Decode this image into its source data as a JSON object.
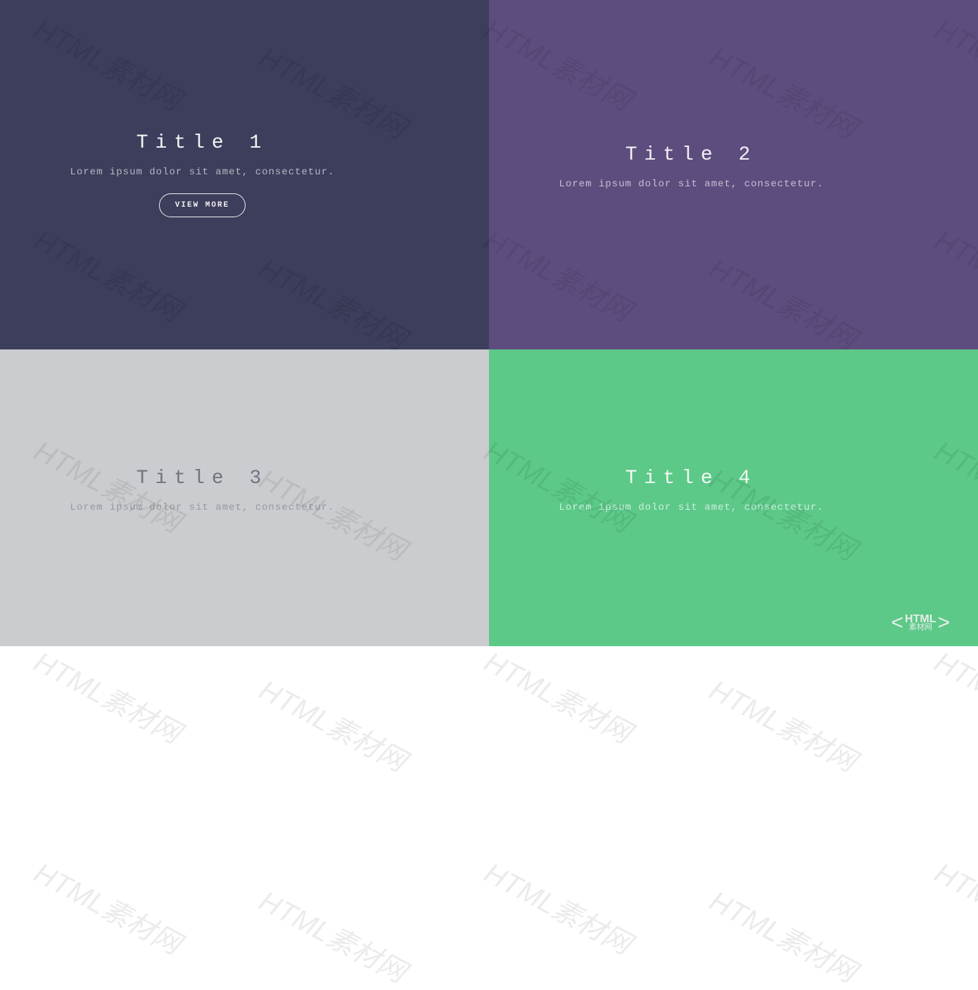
{
  "tiles": [
    {
      "title": "Title 1",
      "subtitle": "Lorem ipsum dolor sit amet, consectetur.",
      "button_label": "VIEW MORE",
      "bg_color": "#3d3d5c",
      "has_button": true
    },
    {
      "title": "Title 2",
      "subtitle": "Lorem ipsum dolor sit amet, consectetur.",
      "bg_color": "#5d4d7e",
      "has_button": false
    },
    {
      "title": "Title 3",
      "subtitle": "Lorem ipsum dolor sit amet, consectetur.",
      "bg_color": "#cbcccf",
      "has_button": false
    },
    {
      "title": "Title 4",
      "subtitle": "Lorem ipsum dolor sit amet, consectetur.",
      "bg_color": "#5cc988",
      "has_button": false
    }
  ],
  "watermark_text": "HTML素材网",
  "logo": {
    "top": "HTML",
    "bottom": "素材网"
  }
}
